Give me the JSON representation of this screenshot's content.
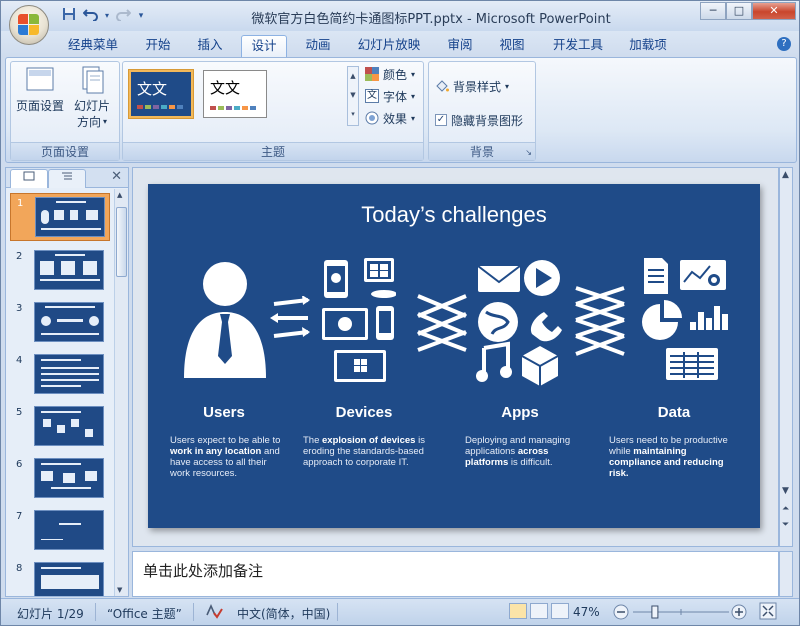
{
  "window": {
    "title": "微软官方白色简约卡通图标PPT.pptx - Microsoft PowerPoint",
    "controls": {
      "minimize": "─",
      "maximize": "□",
      "close": "✕"
    }
  },
  "quick_access": [
    "save-icon",
    "undo-icon",
    "redo-icon",
    "customize-icon"
  ],
  "tabs": [
    {
      "label": "经典菜单"
    },
    {
      "label": "开始"
    },
    {
      "label": "插入"
    },
    {
      "label": "设计",
      "active": true
    },
    {
      "label": "动画"
    },
    {
      "label": "幻灯片放映"
    },
    {
      "label": "审阅"
    },
    {
      "label": "视图"
    },
    {
      "label": "开发工具"
    },
    {
      "label": "加载项"
    }
  ],
  "ribbon": {
    "page_setup": {
      "page_setup_label": "页面设置",
      "orientation_label1": "幻灯片",
      "orientation_label2": "方向",
      "group_label": "页面设置"
    },
    "themes": {
      "theme1_text": "文文",
      "theme2_text": "文文",
      "colors_label": "颜色",
      "fonts_label": "字体",
      "effects_label": "效果",
      "group_label": "主题"
    },
    "background": {
      "styles_label": "背景样式",
      "hide_graphics_label": "隐藏背景图形",
      "hide_graphics_checked": true,
      "group_label": "背景"
    },
    "colors": {
      "accent": "#2b579a",
      "ribbon_bg": "#dde8f5"
    }
  },
  "slides_panel": {
    "close": "✕",
    "slides": [
      {
        "num": "1",
        "selected": true
      },
      {
        "num": "2"
      },
      {
        "num": "3"
      },
      {
        "num": "4"
      },
      {
        "num": "5"
      },
      {
        "num": "6"
      },
      {
        "num": "7"
      },
      {
        "num": "8"
      }
    ]
  },
  "slide": {
    "title": "Today’s challenges",
    "background": "#1f4b88",
    "columns": [
      {
        "title": "Users",
        "desc_parts": [
          "Users expect to be able to ",
          "work in any location",
          " and have access to all their work resources."
        ]
      },
      {
        "title": "Devices",
        "desc_parts": [
          "The ",
          "explosion of devices",
          " is eroding the standards-based approach to corporate IT."
        ]
      },
      {
        "title": "Apps",
        "desc_parts": [
          "Deploying and managing applications ",
          "across platforms",
          " is difficult."
        ]
      },
      {
        "title": "Data",
        "desc_parts": [
          "Users need to be productive while ",
          "maintaining compliance and reducing risk.",
          ""
        ]
      }
    ]
  },
  "notes": {
    "placeholder": "单击此处添加备注"
  },
  "status": {
    "slide_info": "幻灯片 1/29",
    "theme": "“Office 主题”",
    "language": "中文(简体，中国)",
    "zoom": "47%",
    "zoom_value": 0.47
  }
}
